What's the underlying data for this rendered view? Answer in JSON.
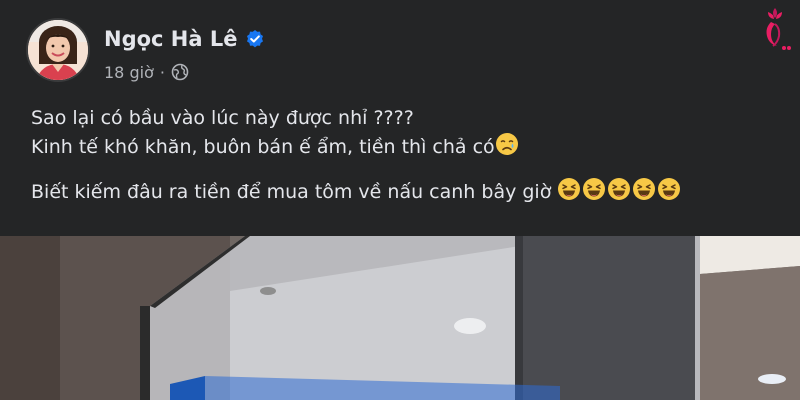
{
  "post": {
    "author": {
      "name": "Ngọc Hà Lê",
      "verified": true,
      "avatar_icon": "profile-photo"
    },
    "meta": {
      "time": "18 giờ",
      "separator": "·",
      "audience_icon": "globe-icon"
    },
    "lines": [
      "Sao lại có bầu vào lúc này được nhỉ ????",
      "Kinh tế khó khăn, buôn bán ế ẩm, tiền thì chả có",
      "Biết kiếm đâu ra tiền để mua tôm về nấu canh bây giờ"
    ],
    "emojis": {
      "line2": [
        "sad-tear-emoji"
      ],
      "line3": [
        "laughing-emoji",
        "laughing-emoji",
        "laughing-emoji",
        "laughing-emoji",
        "laughing-emoji"
      ]
    },
    "watermark_icon": "flower-logo-icon",
    "colors": {
      "background": "#242526",
      "text": "#e4e6eb",
      "secondary_text": "#b0b3b8",
      "verified_blue": "#1877f2",
      "emoji_yellow": "#f7c846"
    },
    "photo": {
      "description_icon": "post-photo"
    }
  }
}
